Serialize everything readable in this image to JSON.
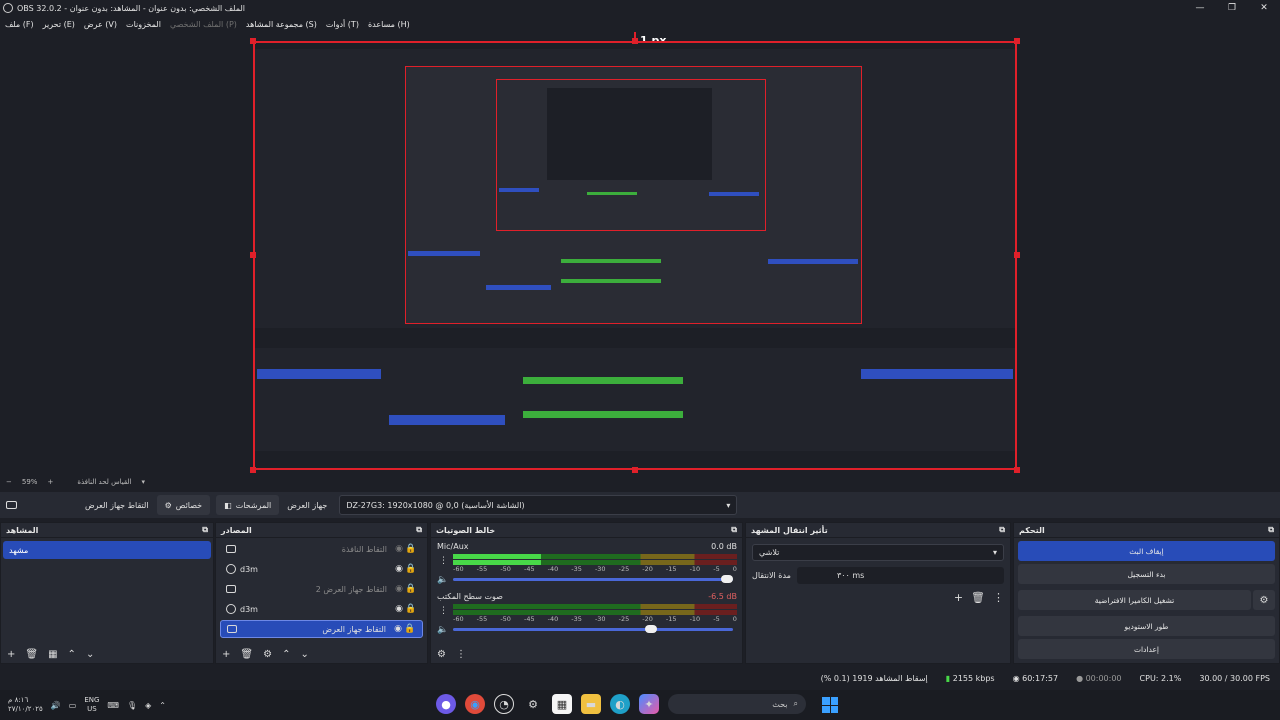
{
  "window": {
    "title": "OBS 32.0.2 - الملف الشخصي: بدون عنوان - المشاهد: بدون عنوان",
    "controls": [
      "—",
      "❐",
      "✕"
    ]
  },
  "menu": [
    {
      "label": "ملف (F)",
      "disabled": false
    },
    {
      "label": "تحرير (E)",
      "disabled": false
    },
    {
      "label": "عرض (V)",
      "disabled": false
    },
    {
      "label": "المخزونات",
      "disabled": false
    },
    {
      "label": "الملف الشخصي (P)",
      "disabled": true
    },
    {
      "label": "مجموعة المشاهد (S)",
      "disabled": false
    },
    {
      "label": "أدوات (T)",
      "disabled": false
    },
    {
      "label": "مساعدة (H)",
      "disabled": false
    }
  ],
  "preview": {
    "size_label": "1 px",
    "accent": "#e0202a"
  },
  "zoom": {
    "minus": "−",
    "value": "59%",
    "plus": "+",
    "fit_label": "القياس لحد النافذة",
    "arrow": "▾"
  },
  "context_bar": {
    "source_name": "التقاط جهاز العرض",
    "properties_label": "خصائص",
    "filters_label": "المرشحات",
    "device_label": "جهاز العرض",
    "device_value": "DZ-27G3: 1920x1080 @ 0,0 (الشاشة الأساسية)"
  },
  "scenes": {
    "title": "المشاهد",
    "items": [
      "مشهد"
    ]
  },
  "sources": {
    "title": "المصادر",
    "items": [
      {
        "name": "التقاط النافذة",
        "icon": "window-icon",
        "muted": true,
        "selected": false,
        "align": "right"
      },
      {
        "name": "d3m",
        "icon": "browser-icon",
        "muted": false,
        "selected": false,
        "align": "left"
      },
      {
        "name": "التقاط جهاز العرض 2",
        "icon": "monitor-icon",
        "muted": true,
        "selected": false,
        "align": "right"
      },
      {
        "name": "d3m",
        "icon": "browser-icon",
        "muted": false,
        "selected": false,
        "align": "left"
      },
      {
        "name": "التقاط جهاز العرض",
        "icon": "monitor-icon",
        "muted": false,
        "selected": true,
        "align": "right"
      }
    ]
  },
  "mixer": {
    "title": "خالط الصوتيات",
    "channels": [
      {
        "name": "Mic/Aux",
        "db": "0.0 dB",
        "level": 0.31,
        "volume": 1.0,
        "red": false
      },
      {
        "name": "صوت سطح المكتب",
        "db": "-6.5 dB",
        "level": 0.0,
        "volume": 0.73,
        "red": true
      }
    ],
    "ticks": [
      "-60",
      "-55",
      "-50",
      "-45",
      "-40",
      "-35",
      "-30",
      "-25",
      "-20",
      "-15",
      "-10",
      "-5",
      "0"
    ]
  },
  "transitions": {
    "title": "تأثير انتقال المشهد",
    "selected": "تلاشي",
    "duration_label": "مدة الانتقال",
    "duration_value": "٣٠٠ ms"
  },
  "controls": {
    "title": "التحكم",
    "stream": "إيقاف البث",
    "record": "بدء التسجيل",
    "virtual_cam": "تشغيل الكاميرا الافتراضية",
    "studio": "طور الاستوديو",
    "settings": "إعدادات"
  },
  "status": {
    "dropped": "إسقاط المشاهد 1919 (0.1 %)",
    "bitrate": "2155 kbps",
    "live_time": "60:17:57",
    "rec_time": "00:00:00",
    "cpu": "CPU: 2.1%",
    "fps": "30.00 / 30.00 FPS"
  },
  "taskbar": {
    "time": "٨:١٦ م",
    "date": "٢٧/١٠/٢٠٢٥",
    "lang_top": "ENG",
    "lang_bottom": "US",
    "search_label": "بحث"
  }
}
